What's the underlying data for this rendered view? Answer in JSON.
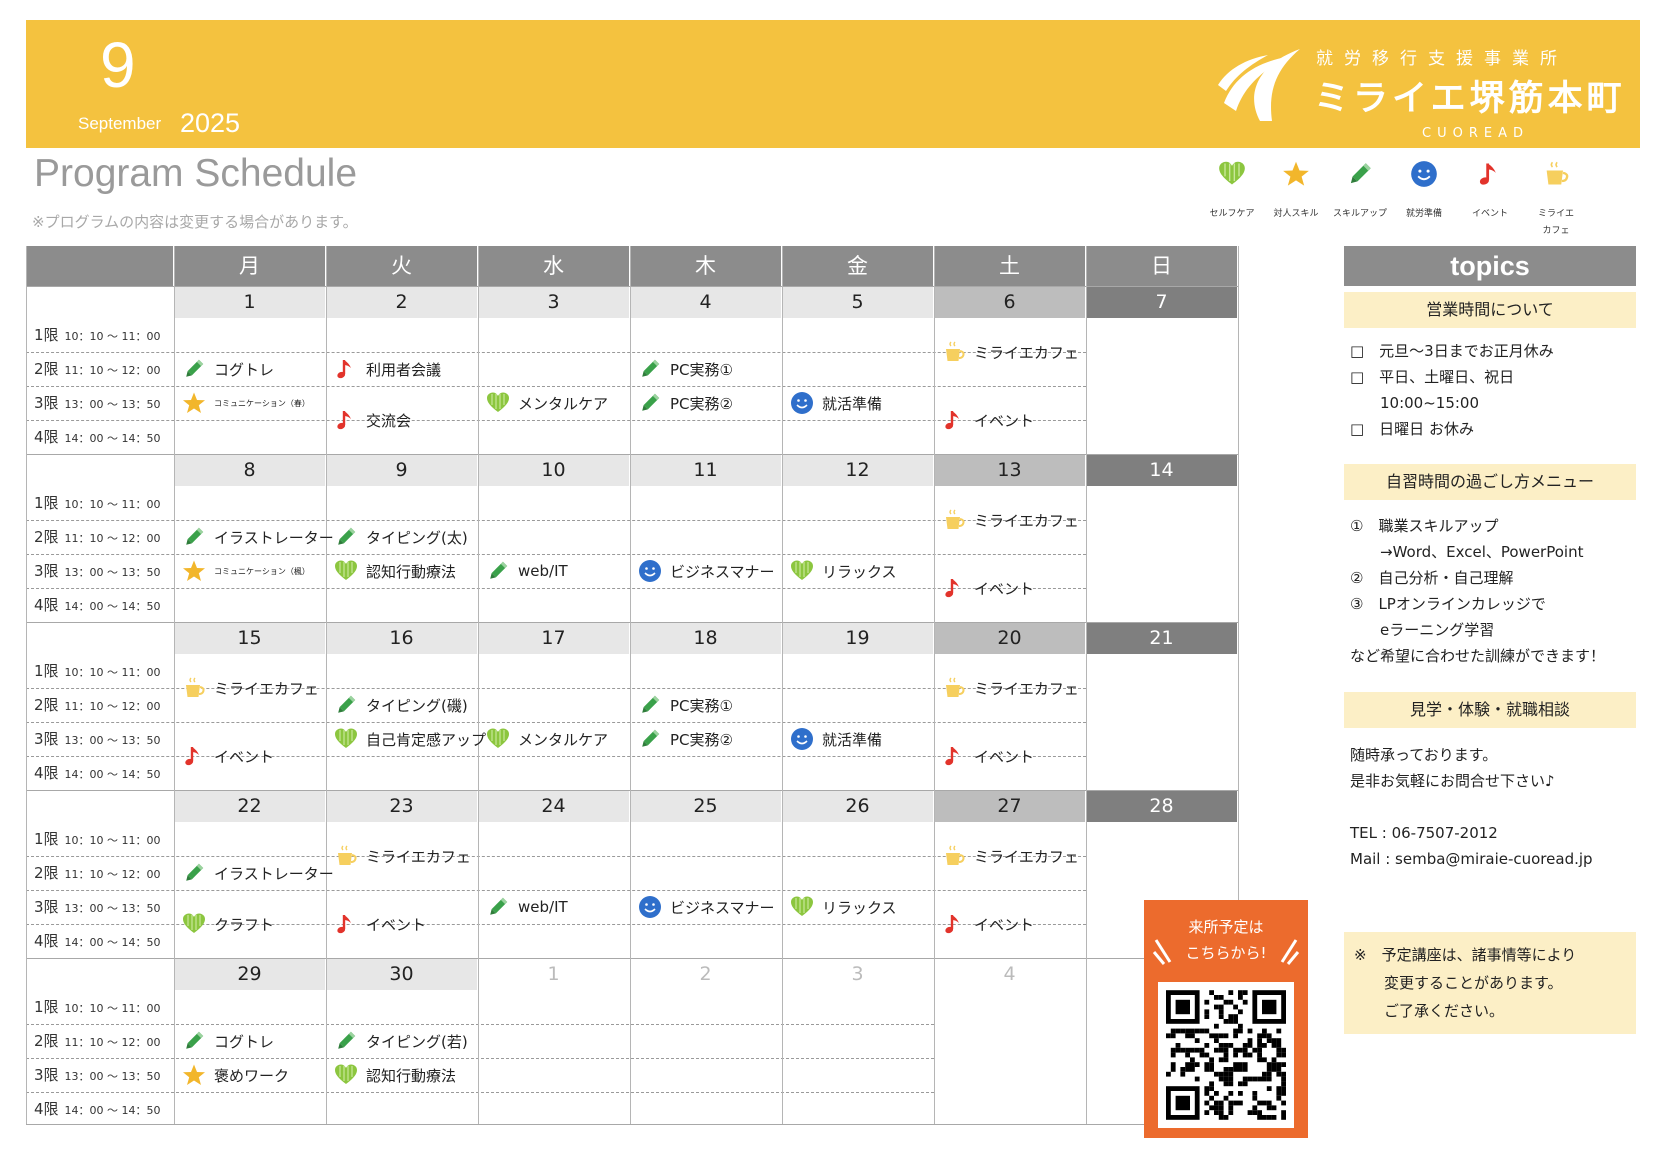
{
  "header": {
    "month_num": "9",
    "month_name": "September",
    "year": "2025",
    "org_sub": "就労移行支援事業所",
    "org_name": "ミライエ堺筋本町",
    "org_en": "CUOREAD"
  },
  "title": "Program Schedule",
  "note": "※プログラムの内容は変更する場合があります。",
  "legend": [
    {
      "icon": "heart-icon",
      "label": "セルフケア"
    },
    {
      "icon": "star-icon",
      "label": "対人スキル"
    },
    {
      "icon": "pencil-icon",
      "label": "スキルアップ"
    },
    {
      "icon": "smiley-icon",
      "label": "就労準備"
    },
    {
      "icon": "music-note-icon",
      "label": "イベント"
    },
    {
      "icon": "cup-icon",
      "label": "ミライエ\nカフェ"
    }
  ],
  "weekdays": [
    "月",
    "火",
    "水",
    "木",
    "金",
    "土",
    "日"
  ],
  "periods": [
    {
      "label": "1限",
      "time": "10：10 ～ 11：00"
    },
    {
      "label": "2限",
      "time": "11：10 ～ 12：00"
    },
    {
      "label": "3限",
      "time": "13：00 ～ 13：50"
    },
    {
      "label": "4限",
      "time": "14：00 ～ 14：50"
    }
  ],
  "weeks": [
    {
      "days": [
        "1",
        "2",
        "3",
        "4",
        "5",
        "6",
        "7"
      ],
      "off": []
    },
    {
      "days": [
        "8",
        "9",
        "10",
        "11",
        "12",
        "13",
        "14"
      ],
      "off": []
    },
    {
      "days": [
        "15",
        "16",
        "17",
        "18",
        "19",
        "20",
        "21"
      ],
      "off": []
    },
    {
      "days": [
        "22",
        "23",
        "24",
        "25",
        "26",
        "27",
        "28"
      ],
      "off": []
    },
    {
      "days": [
        "29",
        "30",
        "1",
        "2",
        "3",
        "4",
        ""
      ],
      "off": [
        2,
        3,
        4,
        5
      ]
    }
  ],
  "events": [
    {
      "w": 0,
      "d": 0,
      "p": 1,
      "span": 1,
      "icon": "pencil-icon",
      "text": "コグトレ"
    },
    {
      "w": 0,
      "d": 0,
      "p": 2,
      "span": 1,
      "icon": "star-icon",
      "text": "コミュニケーション（春）",
      "small": true
    },
    {
      "w": 0,
      "d": 1,
      "p": 1,
      "span": 1,
      "icon": "music-note-icon",
      "text": "利用者会議"
    },
    {
      "w": 0,
      "d": 1,
      "p": 2,
      "span": 2,
      "icon": "music-note-icon",
      "text": "交流会"
    },
    {
      "w": 0,
      "d": 2,
      "p": 2,
      "span": 1,
      "icon": "heart-icon",
      "text": "メンタルケア"
    },
    {
      "w": 0,
      "d": 3,
      "p": 1,
      "span": 1,
      "icon": "pencil-icon",
      "text": "PC実務①"
    },
    {
      "w": 0,
      "d": 3,
      "p": 2,
      "span": 1,
      "icon": "pencil-icon",
      "text": "PC実務②"
    },
    {
      "w": 0,
      "d": 4,
      "p": 2,
      "span": 1,
      "icon": "smiley-icon",
      "text": "就活準備"
    },
    {
      "w": 0,
      "d": 5,
      "p": 0,
      "span": 2,
      "icon": "cup-icon",
      "text": "ミライエカフェ"
    },
    {
      "w": 0,
      "d": 5,
      "p": 2,
      "span": 2,
      "icon": "music-note-icon",
      "text": "イベント"
    },
    {
      "w": 1,
      "d": 0,
      "p": 1,
      "span": 1,
      "icon": "pencil-icon",
      "text": "イラストレーター"
    },
    {
      "w": 1,
      "d": 0,
      "p": 2,
      "span": 1,
      "icon": "star-icon",
      "text": "コミュニケーション（楓）",
      "small": true
    },
    {
      "w": 1,
      "d": 1,
      "p": 1,
      "span": 1,
      "icon": "pencil-icon",
      "text": "タイピング(太)"
    },
    {
      "w": 1,
      "d": 1,
      "p": 2,
      "span": 1,
      "icon": "heart-icon",
      "text": "認知行動療法"
    },
    {
      "w": 1,
      "d": 2,
      "p": 2,
      "span": 1,
      "icon": "pencil-icon",
      "text": "web/IT"
    },
    {
      "w": 1,
      "d": 3,
      "p": 2,
      "span": 1,
      "icon": "smiley-icon",
      "text": "ビジネスマナー"
    },
    {
      "w": 1,
      "d": 4,
      "p": 2,
      "span": 1,
      "icon": "heart-icon",
      "text": "リラックス"
    },
    {
      "w": 1,
      "d": 5,
      "p": 0,
      "span": 2,
      "icon": "cup-icon",
      "text": "ミライエカフェ"
    },
    {
      "w": 1,
      "d": 5,
      "p": 2,
      "span": 2,
      "icon": "music-note-icon",
      "text": "イベント"
    },
    {
      "w": 2,
      "d": 0,
      "p": 0,
      "span": 2,
      "icon": "cup-icon",
      "text": "ミライエカフェ"
    },
    {
      "w": 2,
      "d": 0,
      "p": 2,
      "span": 2,
      "icon": "music-note-icon",
      "text": "イベント"
    },
    {
      "w": 2,
      "d": 1,
      "p": 1,
      "span": 1,
      "icon": "pencil-icon",
      "text": "タイピング(磯)"
    },
    {
      "w": 2,
      "d": 1,
      "p": 2,
      "span": 1,
      "icon": "heart-icon",
      "text": "自己肯定感アップ"
    },
    {
      "w": 2,
      "d": 2,
      "p": 2,
      "span": 1,
      "icon": "heart-icon",
      "text": "メンタルケア"
    },
    {
      "w": 2,
      "d": 3,
      "p": 1,
      "span": 1,
      "icon": "pencil-icon",
      "text": "PC実務①"
    },
    {
      "w": 2,
      "d": 3,
      "p": 2,
      "span": 1,
      "icon": "pencil-icon",
      "text": "PC実務②"
    },
    {
      "w": 2,
      "d": 4,
      "p": 2,
      "span": 1,
      "icon": "smiley-icon",
      "text": "就活準備"
    },
    {
      "w": 2,
      "d": 5,
      "p": 0,
      "span": 2,
      "icon": "cup-icon",
      "text": "ミライエカフェ"
    },
    {
      "w": 2,
      "d": 5,
      "p": 2,
      "span": 2,
      "icon": "music-note-icon",
      "text": "イベント"
    },
    {
      "w": 3,
      "d": 0,
      "p": 1,
      "span": 1,
      "icon": "pencil-icon",
      "text": "イラストレーター"
    },
    {
      "w": 3,
      "d": 0,
      "p": 2,
      "span": 2,
      "icon": "heart-icon",
      "text": "クラフト"
    },
    {
      "w": 3,
      "d": 1,
      "p": 0,
      "span": 2,
      "icon": "cup-icon",
      "text": "ミライエカフェ"
    },
    {
      "w": 3,
      "d": 1,
      "p": 2,
      "span": 2,
      "icon": "music-note-icon",
      "text": "イベント"
    },
    {
      "w": 3,
      "d": 2,
      "p": 2,
      "span": 1,
      "icon": "pencil-icon",
      "text": "web/IT"
    },
    {
      "w": 3,
      "d": 3,
      "p": 2,
      "span": 1,
      "icon": "smiley-icon",
      "text": "ビジネスマナー"
    },
    {
      "w": 3,
      "d": 4,
      "p": 2,
      "span": 1,
      "icon": "heart-icon",
      "text": "リラックス"
    },
    {
      "w": 3,
      "d": 5,
      "p": 0,
      "span": 2,
      "icon": "cup-icon",
      "text": "ミライエカフェ"
    },
    {
      "w": 3,
      "d": 5,
      "p": 2,
      "span": 2,
      "icon": "music-note-icon",
      "text": "イベント"
    },
    {
      "w": 4,
      "d": 0,
      "p": 1,
      "span": 1,
      "icon": "pencil-icon",
      "text": "コグトレ"
    },
    {
      "w": 4,
      "d": 0,
      "p": 2,
      "span": 1,
      "icon": "star-icon",
      "text": "褒めワーク"
    },
    {
      "w": 4,
      "d": 1,
      "p": 1,
      "span": 1,
      "icon": "pencil-icon",
      "text": "タイピング(若)"
    },
    {
      "w": 4,
      "d": 1,
      "p": 2,
      "span": 1,
      "icon": "heart-icon",
      "text": "認知行動療法"
    }
  ],
  "qr": {
    "text_line1": "来所予定は",
    "text_line2": "こちらから!"
  },
  "topics": {
    "title": "topics",
    "sections": [
      {
        "heading": "営業時間について",
        "lines": [
          "□　元旦～3日までお正月休み",
          "□　平日、土曜日、祝日",
          "　　10:00~15:00",
          "□　日曜日 お休み"
        ]
      },
      {
        "heading": "自習時間の過ごし方メニュー",
        "lines": [
          "①　職業スキルアップ",
          "　　→Word、Excel、PowerPoint",
          "②　自己分析・自己理解",
          "③　LPオンラインカレッジで",
          "　　eラーニング学習",
          "など希望に合わせた訓練ができます！"
        ]
      },
      {
        "heading": "見学・体験・就職相談",
        "lines": [
          "随時承っております。",
          "是非お気軽にお問合せ下さい♪",
          "",
          "TEL : 06-7507-2012",
          "Mail : semba@miraie-cuoread.jp"
        ]
      }
    ],
    "note_lines": [
      "※　予定講座は、諸事情等により",
      "　　変更することがあります。",
      "　　ご了承ください。"
    ]
  },
  "colors": {
    "accent": "#f4c23f",
    "orange": "#ec6b2d",
    "header_gray": "#8c8c8c"
  }
}
